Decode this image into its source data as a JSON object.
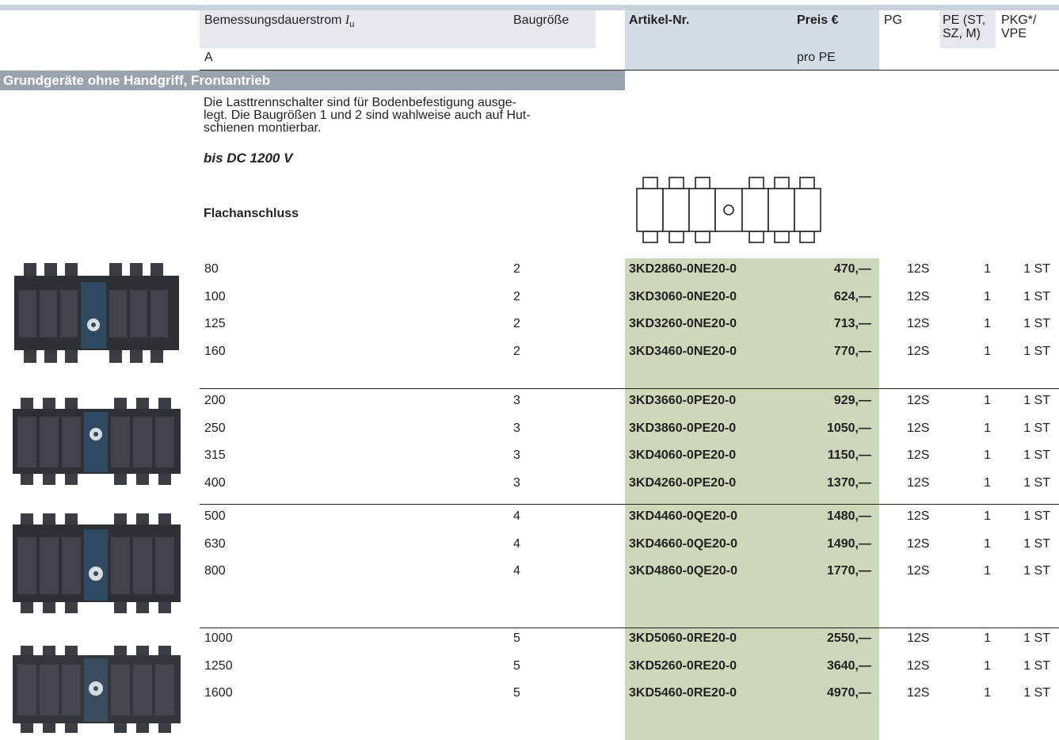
{
  "header": {
    "col_current": "Bemessungsdauerstrom",
    "col_current_symbol": "I",
    "col_current_sub": "u",
    "col_size": "Baugröße",
    "col_article": "Artikel-Nr.",
    "col_price": "Preis €",
    "col_pg": "PG",
    "col_pe_line1": "PE (ST,",
    "col_pe_line2": "SZ, M)",
    "col_pkg_line1": "PKG*/",
    "col_pkg_line2": "VPE",
    "unit_current": "A",
    "unit_price": "pro PE"
  },
  "section": {
    "title": "Grundgeräte ohne Handgriff, Frontantrieb",
    "desc_line1": "Die Lasttrennschalter sind für Bodenbefestigung ausge-",
    "desc_line2": "legt. Die Baugrößen 1 und 2 sind wahlweise auch auf Hut-",
    "desc_line3": "schienen montierbar.",
    "voltage": "bis DC 1200 V",
    "connection": "Flachanschluss"
  },
  "groups": [
    {
      "rows": [
        {
          "current": "80",
          "size": "2",
          "article": "3KD2860-0NE20-0",
          "price": "470,—",
          "pg": "12S",
          "pe": "1",
          "pkg": "1 ST"
        },
        {
          "current": "100",
          "size": "2",
          "article": "3KD3060-0NE20-0",
          "price": "624,—",
          "pg": "12S",
          "pe": "1",
          "pkg": "1 ST"
        },
        {
          "current": "125",
          "size": "2",
          "article": "3KD3260-0NE20-0",
          "price": "713,—",
          "pg": "12S",
          "pe": "1",
          "pkg": "1 ST"
        },
        {
          "current": "160",
          "size": "2",
          "article": "3KD3460-0NE20-0",
          "price": "770,—",
          "pg": "12S",
          "pe": "1",
          "pkg": "1 ST"
        }
      ]
    },
    {
      "rows": [
        {
          "current": "200",
          "size": "3",
          "article": "3KD3660-0PE20-0",
          "price": "929,—",
          "pg": "12S",
          "pe": "1",
          "pkg": "1 ST"
        },
        {
          "current": "250",
          "size": "3",
          "article": "3KD3860-0PE20-0",
          "price": "1050,—",
          "pg": "12S",
          "pe": "1",
          "pkg": "1 ST"
        },
        {
          "current": "315",
          "size": "3",
          "article": "3KD4060-0PE20-0",
          "price": "1150,—",
          "pg": "12S",
          "pe": "1",
          "pkg": "1 ST"
        },
        {
          "current": "400",
          "size": "3",
          "article": "3KD4260-0PE20-0",
          "price": "1370,—",
          "pg": "12S",
          "pe": "1",
          "pkg": "1 ST"
        }
      ]
    },
    {
      "rows": [
        {
          "current": "500",
          "size": "4",
          "article": "3KD4460-0QE20-0",
          "price": "1480,—",
          "pg": "12S",
          "pe": "1",
          "pkg": "1 ST"
        },
        {
          "current": "630",
          "size": "4",
          "article": "3KD4660-0QE20-0",
          "price": "1490,—",
          "pg": "12S",
          "pe": "1",
          "pkg": "1 ST"
        },
        {
          "current": "800",
          "size": "4",
          "article": "3KD4860-0QE20-0",
          "price": "1770,—",
          "pg": "12S",
          "pe": "1",
          "pkg": "1 ST"
        }
      ]
    },
    {
      "rows": [
        {
          "current": "1000",
          "size": "5",
          "article": "3KD5060-0RE20-0",
          "price": "2550,—",
          "pg": "12S",
          "pe": "1",
          "pkg": "1 ST"
        },
        {
          "current": "1250",
          "size": "5",
          "article": "3KD5260-0RE20-0",
          "price": "3640,—",
          "pg": "12S",
          "pe": "1",
          "pkg": "1 ST"
        },
        {
          "current": "1600",
          "size": "5",
          "article": "3KD5460-0RE20-0",
          "price": "4970,—",
          "pg": "12S",
          "pe": "1",
          "pkg": "1 ST"
        }
      ]
    }
  ]
}
